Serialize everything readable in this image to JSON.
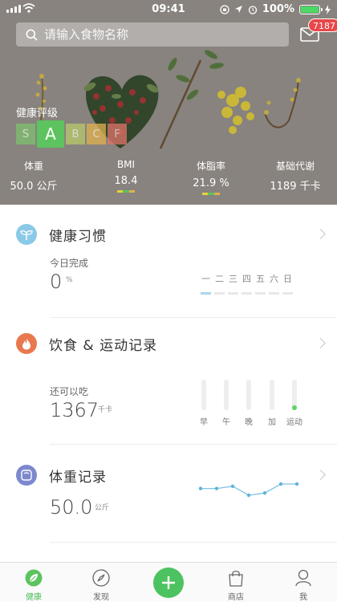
{
  "status_bar": {
    "time": "09:41",
    "battery": "100%"
  },
  "search": {
    "placeholder": "请输入食物名称"
  },
  "mail": {
    "badge": "7187"
  },
  "grade": {
    "title": "健康评级",
    "levels": [
      {
        "letter": "S",
        "color": "#7ec16f"
      },
      {
        "letter": "A",
        "color": "#5cc35e"
      },
      {
        "letter": "B",
        "color": "#b8c96a"
      },
      {
        "letter": "C",
        "color": "#e0b24e"
      },
      {
        "letter": "F",
        "color": "#e2736a"
      }
    ],
    "active": "A"
  },
  "stats": [
    {
      "label": "体重",
      "value": "50.0 公斤"
    },
    {
      "label": "BMI",
      "value": "18.4"
    },
    {
      "label": "体脂率",
      "value": "21.9 %"
    },
    {
      "label": "基础代谢",
      "value": "1189 千卡"
    }
  ],
  "habits": {
    "title": "健康习惯",
    "today_label": "今日完成",
    "value": "0",
    "unit": "%",
    "days": [
      "一",
      "二",
      "三",
      "四",
      "五",
      "六",
      "日"
    ],
    "active_day": 0
  },
  "diet": {
    "title": "饮食 & 运动记录",
    "remain_label": "还可以吃",
    "value": "1367",
    "unit": "千卡",
    "meals": [
      "早",
      "午",
      "晚",
      "加",
      "运动"
    ],
    "exercise_done": true
  },
  "weight": {
    "title": "体重记录",
    "value": "50.0",
    "unit": "公斤",
    "trend": [
      50.3,
      50.3,
      50.4,
      50.0,
      50.1,
      50.5,
      50.5
    ]
  },
  "tabs": [
    {
      "label": "健康",
      "icon": "leaf-icon"
    },
    {
      "label": "发现",
      "icon": "compass-icon"
    },
    {
      "label": "",
      "icon": "plus-icon"
    },
    {
      "label": "商店",
      "icon": "shopping-bag-icon"
    },
    {
      "label": "我",
      "icon": "profile-icon"
    }
  ],
  "colors": {
    "accent": "#4cc260",
    "habit_icon": "#8ac9e8",
    "diet_icon": "#e8794e",
    "weight_icon": "#7d88cf",
    "badge": "#e8474b"
  }
}
